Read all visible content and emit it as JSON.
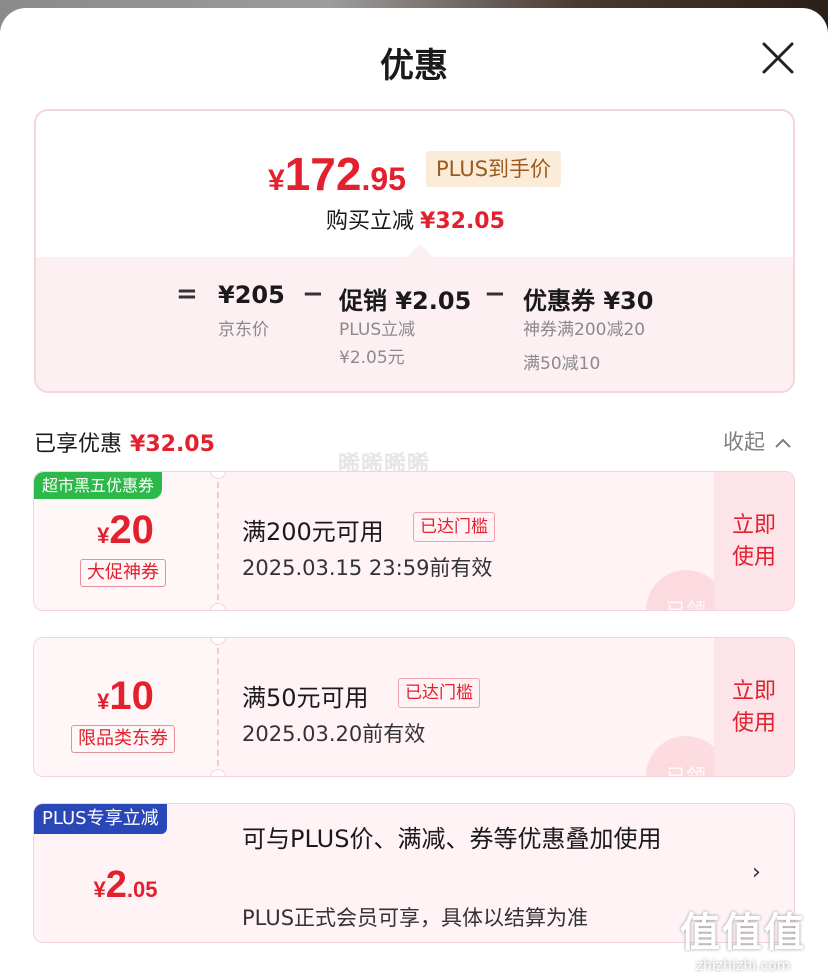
{
  "sheet": {
    "title": "优惠"
  },
  "summary": {
    "final_price": {
      "yen": "¥",
      "integer": "172",
      "decimal": ".95"
    },
    "plus_tag": "PLUS到手价",
    "buy_reduce_label": "购买立减",
    "buy_reduce_amount": "¥32.05",
    "breakdown": {
      "eq": "=",
      "minus": "−",
      "jd_price": "¥205",
      "jd_price_label": "京东价",
      "promo": "促销 ¥2.05",
      "promo_sub1": "PLUS立减",
      "promo_sub2": "¥2.05元",
      "coupon": "优惠券 ¥30",
      "coupon_sub1": "神券满200减20",
      "coupon_sub2": "满50减10"
    }
  },
  "enjoyed": {
    "label": "已享优惠",
    "amount": "¥32.05",
    "collapse_label": "收起",
    "watermark": "晞晞晞晞"
  },
  "coupons": [
    {
      "badge": "超市黑五优惠券",
      "yen": "¥",
      "amount": "20",
      "type": "大促神券",
      "condition": "满200元可用",
      "reached": "已达门槛",
      "validity": "2025.03.15 23:59前有效",
      "use_label_1": "立即",
      "use_label_2": "使用",
      "stamp": "已领"
    },
    {
      "yen": "¥",
      "amount": "10",
      "type": "限品类东券",
      "condition": "满50元可用",
      "reached": "已达门槛",
      "validity": "2025.03.20前有效",
      "use_label_1": "立即",
      "use_label_2": "使用",
      "stamp": "已领"
    }
  ],
  "plus_offer": {
    "badge": "PLUS专享立减",
    "yen": "¥",
    "integer": "2",
    "decimal": ".05",
    "description": "可与PLUS价、满减、券等优惠叠加使用",
    "note": "PLUS正式会员可享，具体以结算为准",
    "arrow": "›"
  },
  "site_watermark": {
    "logo": "值值值",
    "url": "zhizhizhi.com"
  },
  "colors": {
    "accent_red": "#e3202e",
    "plus_gold_bg": "#fbecd9",
    "plus_blue": "#2a47b8",
    "coupon_green": "#2db84a"
  },
  "icons": {
    "close": "close-icon",
    "collapse": "chevron-up-icon",
    "arrow": "chevron-right-icon"
  }
}
